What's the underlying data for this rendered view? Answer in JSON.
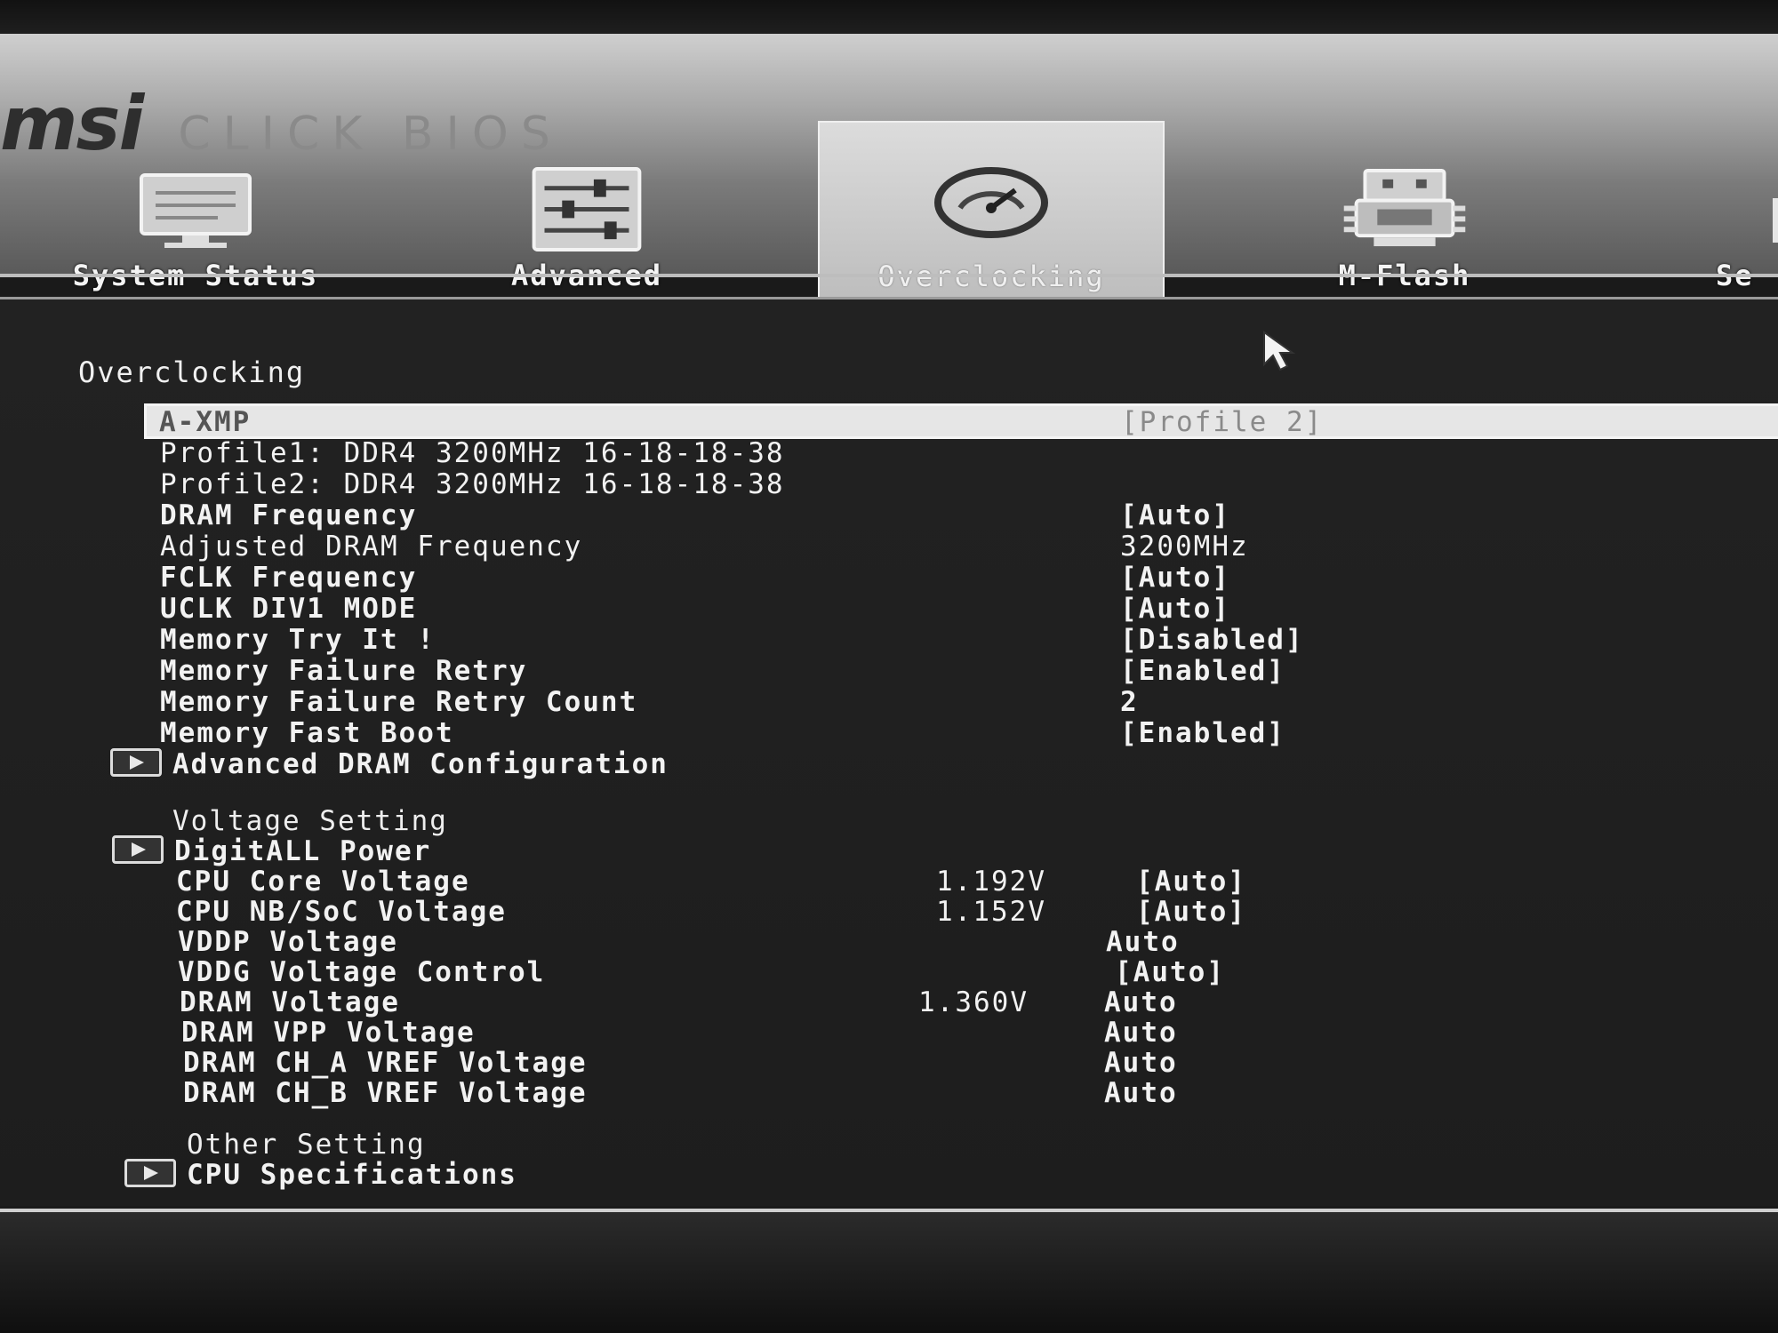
{
  "branding": {
    "brand": "msi",
    "product": "CLICK BIOS"
  },
  "tabs": [
    {
      "label": "System Status",
      "icon": "monitor-icon"
    },
    {
      "label": "Advanced",
      "icon": "sliders-icon"
    },
    {
      "label": "Overclocking",
      "icon": "speedometer-icon",
      "active": true
    },
    {
      "label": "M-Flash",
      "icon": "bios-chip-icon"
    },
    {
      "label": "Se",
      "icon": "settings-icon"
    }
  ],
  "section_title": "Overclocking",
  "rows": [
    {
      "label": "A-XMP",
      "value": "[Profile 2]",
      "selected": true
    },
    {
      "label": "Profile1: DDR4 3200MHz 16-18-18-38",
      "info": true
    },
    {
      "label": "Profile2: DDR4 3200MHz 16-18-18-38",
      "info": true
    },
    {
      "label": "DRAM Frequency",
      "value": "[Auto]"
    },
    {
      "label": "Adjusted DRAM Frequency",
      "value": "3200MHz"
    },
    {
      "label": "FCLK Frequency",
      "value": "[Auto]"
    },
    {
      "label": "UCLK DIV1 MODE",
      "value": "[Auto]"
    },
    {
      "label": "Memory Try It !",
      "value": "[Disabled]"
    },
    {
      "label": "Memory Failure Retry",
      "value": "[Enabled]"
    },
    {
      "label": "Memory Failure Retry Count",
      "value": "2"
    },
    {
      "label": "Memory Fast Boot",
      "value": "[Enabled]"
    },
    {
      "label": "Advanced DRAM Configuration",
      "submenu": true
    }
  ],
  "voltage_setting": {
    "heading": "Voltage Setting",
    "rows": [
      {
        "label": "DigitALL Power",
        "submenu": true
      },
      {
        "label": "CPU Core Voltage",
        "reading": "1.192V",
        "value": "[Auto]"
      },
      {
        "label": "CPU NB/SoC Voltage",
        "reading": "1.152V",
        "value": "[Auto]"
      },
      {
        "label": "VDDP Voltage",
        "value": "Auto"
      },
      {
        "label": "VDDG Voltage Control",
        "value": "[Auto]"
      },
      {
        "label": "DRAM Voltage",
        "reading": "1.360V",
        "value": "Auto"
      },
      {
        "label": "DRAM VPP Voltage",
        "value": "Auto"
      },
      {
        "label": "DRAM CH_A VREF Voltage",
        "value": "Auto"
      },
      {
        "label": "DRAM CH_B VREF Voltage",
        "value": "Auto"
      }
    ]
  },
  "other_setting": {
    "heading": "Other Setting",
    "rows": [
      {
        "label": "CPU Specifications",
        "submenu": true
      }
    ]
  }
}
